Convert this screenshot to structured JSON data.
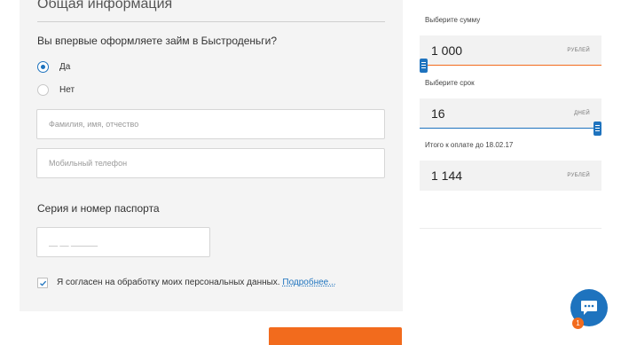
{
  "form": {
    "section_title": "Общая информация",
    "question": "Вы впервые оформляете займ в Быстроденьги?",
    "radio_yes": "Да",
    "radio_no": "Нет",
    "full_name_placeholder": "Фамилия, имя, отчество",
    "phone_placeholder": "Мобильный телефон",
    "passport_label": "Серия и номер паспорта",
    "passport_placeholder": "__ __ ______",
    "consent_text": "Я согласен на обработку моих персональных данных.",
    "consent_link": "Подробнее...",
    "consent_checked": true,
    "first_time_answer": "yes"
  },
  "calculator": {
    "amount_label": "Выберите сумму",
    "amount_value": "1 000",
    "amount_unit": "РУБЛЕЙ",
    "amount_fraction": 0.0,
    "term_label": "Выберите срок",
    "term_value": "16",
    "term_unit": "ДНЕЙ",
    "term_fraction": 1.0,
    "total_label": "Итого к оплате до 18.02.17",
    "total_value": "1 144",
    "total_unit": "РУБЛЕЙ"
  },
  "chat": {
    "badge_count": "1"
  },
  "colors": {
    "accent_blue": "#1e73be",
    "accent_orange": "#f26b1d",
    "panel_bg": "#f4f4f4"
  }
}
